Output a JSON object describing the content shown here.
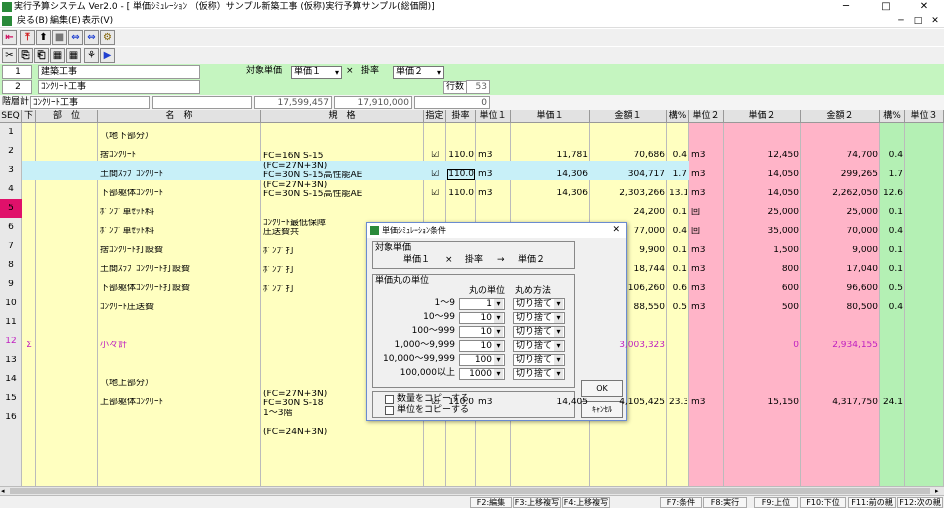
{
  "window": {
    "title": "実行予算システム Ver2.0 - [ 単価ｼﾐｭﾚｰｼｮﾝ （仮称）サンプル新築工事 (仮称)実行予算サンプル(総価開)]",
    "min": "─",
    "max": "□",
    "close": "✕"
  },
  "menu": {
    "items": [
      "戻る(B)",
      "編集(E)",
      "表示(V)"
    ],
    "mdi_min": "─",
    "mdi_max": "□",
    "mdi_close": "✕"
  },
  "toolbar1": [
    "⇤",
    "⤒",
    "⬆",
    "■",
    "⇔",
    "⇔",
    "⚙"
  ],
  "toolbar2": [
    "✂",
    "⎘",
    "⎗",
    "▦",
    "▦",
    "⚘",
    "▶"
  ],
  "info": {
    "row1_no": "1",
    "row1_name": "建築工事",
    "row2_no": "2",
    "row2_name": "ｺﾝｸﾘｰﾄ工事",
    "target_label": "対象単価",
    "target_value": "単価１",
    "times": "×",
    "rate_label": "掛率",
    "rate_value": "単価２",
    "lines_label": "行数",
    "lines_value": "53"
  },
  "summary": {
    "label": "階層計",
    "name": "ｺﾝｸﾘｰﾄ工事",
    "amount1": "17,599,457",
    "amount2": "17,910,000",
    "zero": "0"
  },
  "columns": [
    "SEQ",
    "下",
    "部　位",
    "名　称",
    "規　格",
    "指定",
    "掛率",
    "単位１",
    "単価１",
    "金額１",
    "構%",
    "単位２",
    "単価２",
    "金額２",
    "構%",
    "単位３"
  ],
  "rows": [
    {
      "seq": "1",
      "down": "",
      "name": "（地下部分）",
      "spec1": "",
      "spec2": "",
      "check": "",
      "rate": "",
      "unit1": "",
      "price1": "",
      "amount1": "",
      "pct1": "",
      "unit2": "",
      "price2": "",
      "amount2": "",
      "pct2": ""
    },
    {
      "seq": "2",
      "down": "",
      "name": "捨ｺﾝｸﾘｰﾄ",
      "spec1": "",
      "spec2": "FC=16N S-15",
      "check": "☑",
      "rate": "110.0",
      "unit1": "m3",
      "price1": "11,781",
      "amount1": "70,686",
      "pct1": "0.4",
      "unit2": "m3",
      "price2": "12,450",
      "amount2": "74,700",
      "pct2": "0.4"
    },
    {
      "seq": "3",
      "down": "",
      "name": "土間ｽﾗﾌﾞｺﾝｸﾘｰﾄ",
      "spec1": "(FC=27N+3N)",
      "spec2": "FC=30N S-15高性能AE",
      "check": "☑",
      "rate": "110.0",
      "unit1": "m3",
      "price1": "14,306",
      "amount1": "304,717",
      "pct1": "1.7",
      "unit2": "m3",
      "price2": "14,050",
      "amount2": "299,265",
      "pct2": "1.7"
    },
    {
      "seq": "4",
      "down": "",
      "name": "下部躯体ｺﾝｸﾘｰﾄ",
      "spec1": "(FC=27N+3N)",
      "spec2": "FC=30N S-15高性能AE",
      "check": "☑",
      "rate": "110.0",
      "unit1": "m3",
      "price1": "14,306",
      "amount1": "2,303,266",
      "pct1": "13.1",
      "unit2": "m3",
      "price2": "14,050",
      "amount2": "2,262,050",
      "pct2": "12.6"
    },
    {
      "seq": "5",
      "down": "",
      "name": "ﾎﾟﾝﾌﾟ車ｾｯﾄ料",
      "spec1": "",
      "spec2": "",
      "check": "",
      "rate": "",
      "unit1": "",
      "price1": "",
      "amount1": "24,200",
      "pct1": "0.1",
      "unit2": "回",
      "price2": "25,000",
      "amount2": "25,000",
      "pct2": "0.1"
    },
    {
      "seq": "6",
      "down": "",
      "name": "ﾎﾟﾝﾌﾟ車ｾｯﾄ料",
      "spec1": "ｺﾝｸﾘｰﾄ最低保障",
      "spec2": "圧送費共",
      "check": "",
      "rate": "",
      "unit1": "",
      "price1": "",
      "amount1": "77,000",
      "pct1": "0.4",
      "unit2": "回",
      "price2": "35,000",
      "amount2": "70,000",
      "pct2": "0.4"
    },
    {
      "seq": "7",
      "down": "",
      "name": "捨ｺﾝｸﾘｰﾄ打設費",
      "spec1": "",
      "spec2": "ﾎﾟﾝﾌﾟ打",
      "check": "",
      "rate": "",
      "unit1": "",
      "price1": "",
      "amount1": "9,900",
      "pct1": "0.1",
      "unit2": "m3",
      "price2": "1,500",
      "amount2": "9,000",
      "pct2": "0.1"
    },
    {
      "seq": "8",
      "down": "",
      "name": "土間ｽﾗﾌﾞｺﾝｸﾘｰﾄ打設費",
      "spec1": "",
      "spec2": "ﾎﾟﾝﾌﾟ打",
      "check": "",
      "rate": "",
      "unit1": "",
      "price1": "",
      "amount1": "18,744",
      "pct1": "0.1",
      "unit2": "m3",
      "price2": "800",
      "amount2": "17,040",
      "pct2": "0.1"
    },
    {
      "seq": "9",
      "down": "",
      "name": "下部躯体ｺﾝｸﾘｰﾄ打設費",
      "spec1": "",
      "spec2": "ﾎﾟﾝﾌﾟ打",
      "check": "",
      "rate": "",
      "unit1": "",
      "price1": "",
      "amount1": "106,260",
      "pct1": "0.6",
      "unit2": "m3",
      "price2": "600",
      "amount2": "96,600",
      "pct2": "0.5"
    },
    {
      "seq": "10",
      "down": "",
      "name": "ｺﾝｸﾘｰﾄ圧送費",
      "spec1": "",
      "spec2": "",
      "check": "",
      "rate": "",
      "unit1": "",
      "price1": "",
      "amount1": "88,550",
      "pct1": "0.5",
      "unit2": "m3",
      "price2": "500",
      "amount2": "80,500",
      "pct2": "0.4"
    },
    {
      "seq": "11",
      "down": "",
      "name": "",
      "spec1": "",
      "spec2": "",
      "check": "",
      "rate": "",
      "unit1": "",
      "price1": "",
      "amount1": "",
      "pct1": "",
      "unit2": "",
      "price2": "",
      "amount2": "",
      "pct2": ""
    },
    {
      "seq": "12",
      "down": "Σ",
      "name": "小々計",
      "spec1": "",
      "spec2": "",
      "check": "",
      "rate": "",
      "unit1": "",
      "price1": "",
      "amount1": "3,003,323",
      "pct1": "",
      "unit2": "",
      "price2": "0",
      "amount2": "2,934,155",
      "pct2": ""
    },
    {
      "seq": "13",
      "down": "",
      "name": "",
      "spec1": "",
      "spec2": "",
      "check": "",
      "rate": "",
      "unit1": "",
      "price1": "",
      "amount1": "",
      "pct1": "",
      "unit2": "",
      "price2": "",
      "amount2": "",
      "pct2": ""
    },
    {
      "seq": "14",
      "down": "",
      "name": "（地上部分）",
      "spec1": "",
      "spec2": "",
      "check": "",
      "rate": "",
      "unit1": "",
      "price1": "",
      "amount1": "",
      "pct1": "",
      "unit2": "",
      "price2": "",
      "amount2": "",
      "pct2": ""
    },
    {
      "seq": "15",
      "down": "",
      "name": "上部躯体ｺﾝｸﾘｰﾄ",
      "spec1": "(FC=27N+3N)",
      "spec2": "FC=30N S-18",
      "check": "☑",
      "rate": "110.0",
      "unit1": "m3",
      "price1": "14,405",
      "amount1": "4,105,425",
      "pct1": "23.3",
      "unit2": "m3",
      "price2": "15,150",
      "amount2": "4,317,750",
      "pct2": "24.1"
    },
    {
      "seq": "16",
      "down": "",
      "name": "",
      "spec1": "1～3階",
      "spec2": "",
      "check": "",
      "rate": "",
      "unit1": "",
      "price1": "",
      "amount1": "",
      "pct1": "",
      "unit2": "",
      "price2": "",
      "amount2": "",
      "pct2": ""
    },
    {
      "seq": "",
      "down": "",
      "name": "",
      "spec1": "(FC=24N+3N)",
      "spec2": "",
      "check": "",
      "rate": "",
      "unit1": "",
      "price1": "",
      "amount1": "",
      "pct1": "",
      "unit2": "",
      "price2": "",
      "amount2": "",
      "pct2": ""
    }
  ],
  "dialog": {
    "title": "単価ｼﾐｭﾚｰｼｮﾝ条件",
    "close": "✕",
    "target_group": "対象単価",
    "formula_a": "単価１",
    "formula_x": "×",
    "formula_b": "掛率",
    "formula_arrow": "→",
    "formula_c": "単価２",
    "round_group": "単価丸の単位",
    "col_unit": "丸の単位",
    "col_method": "丸め方法",
    "ranges": [
      {
        "label": "1～9",
        "unit": "1",
        "method": "切り捨て"
      },
      {
        "label": "10～99",
        "unit": "10",
        "method": "切り捨て"
      },
      {
        "label": "100～999",
        "unit": "10",
        "method": "切り捨て"
      },
      {
        "label": "1,000～9,999",
        "unit": "10",
        "method": "切り捨て"
      },
      {
        "label": "10,000～99,999",
        "unit": "100",
        "method": "切り捨て"
      },
      {
        "label": "100,000以上",
        "unit": "1000",
        "method": "切り捨て"
      }
    ],
    "ok": "OK",
    "cancel": "ｷｬﾝｾﾙ",
    "copy_qty": "数量をコピーする",
    "copy_unit": "単位をコピーする"
  },
  "status": {
    "keys": [
      "F2:編集",
      "F3:上移複写",
      "F4:上移複写",
      "F7:条件",
      "F8:実行",
      "F9:上位",
      "F10:下位",
      "F11:前の親",
      "F12:次の親"
    ]
  },
  "colors": {
    "yellow": "#ffffc0",
    "pink": "#ffb4c8",
    "green": "#b4f0b4",
    "cyan": "#c8f0f8",
    "panel": "#c5f5c0"
  }
}
